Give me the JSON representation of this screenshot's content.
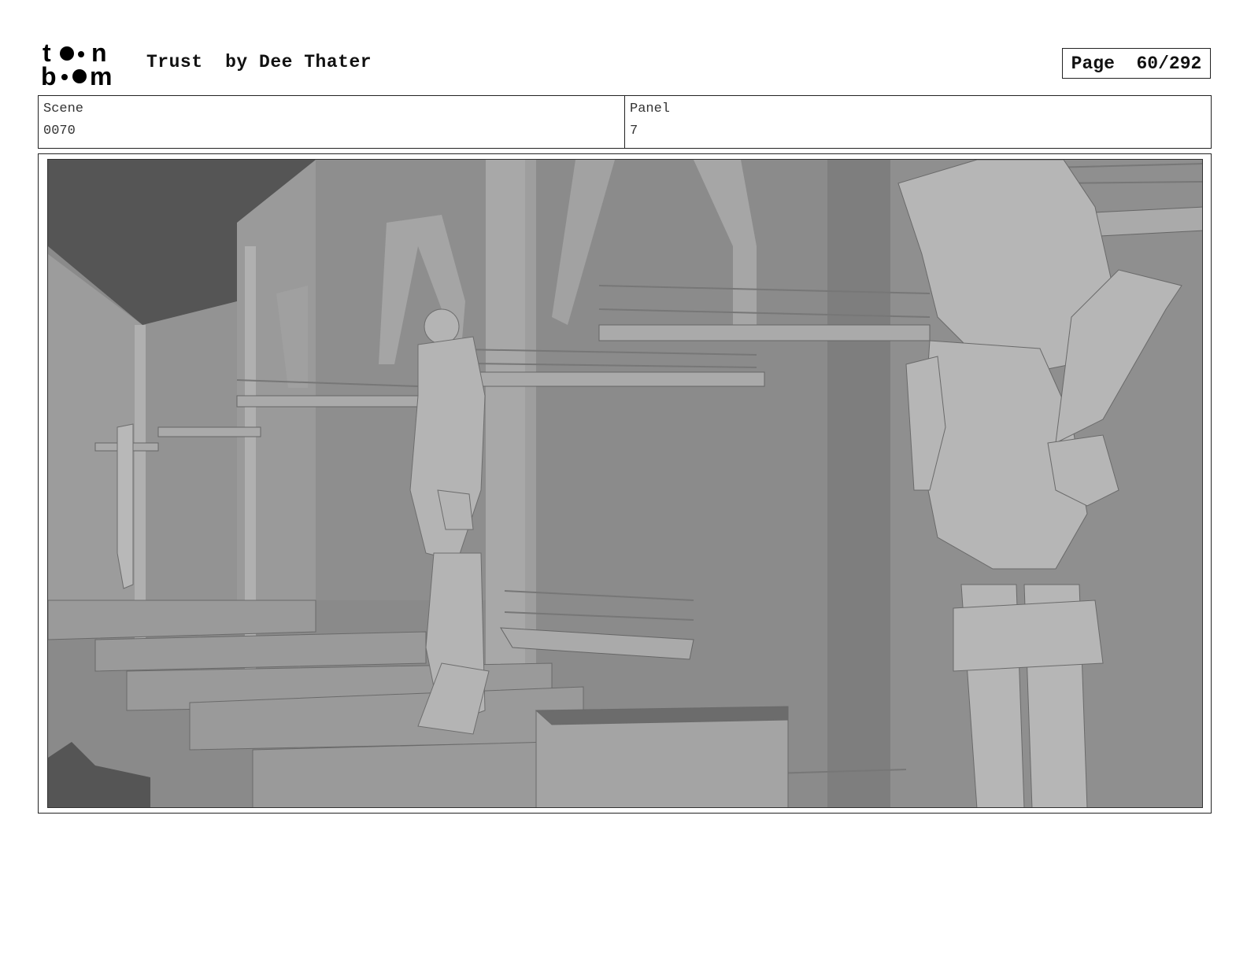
{
  "header": {
    "logo_text": "toon boom",
    "title": "Trust  by Dee Thater",
    "page_label": "Page  60/292"
  },
  "info": {
    "scene_label": "Scene",
    "scene_value": "0070",
    "panel_label": "Panel",
    "panel_value": "7"
  },
  "panel": {
    "image_icon": "storyboard-render"
  }
}
